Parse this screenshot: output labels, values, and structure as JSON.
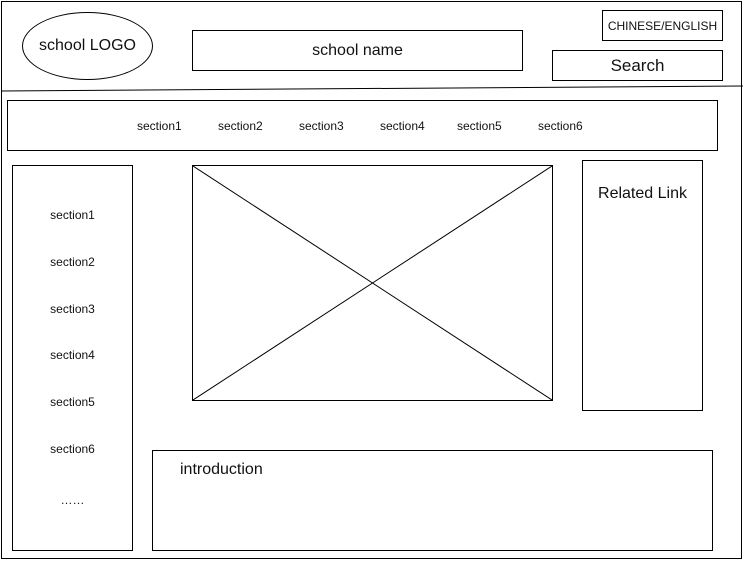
{
  "header": {
    "logo_label": "school LOGO",
    "school_name": "school name",
    "language_toggle": "CHINESE/ENGLISH",
    "search_label": "Search"
  },
  "top_nav": {
    "items": [
      "section1",
      "section2",
      "section3",
      "section4",
      "section5",
      "section6"
    ]
  },
  "side_nav": {
    "items": [
      "section1",
      "section2",
      "section3",
      "section4",
      "section5",
      "section6"
    ],
    "more": "……"
  },
  "main": {
    "image_placeholder": "image-placeholder"
  },
  "related": {
    "title": "Related Link"
  },
  "intro": {
    "label": "introduction"
  },
  "colors": {
    "stroke": "#000000",
    "background": "#ffffff"
  }
}
